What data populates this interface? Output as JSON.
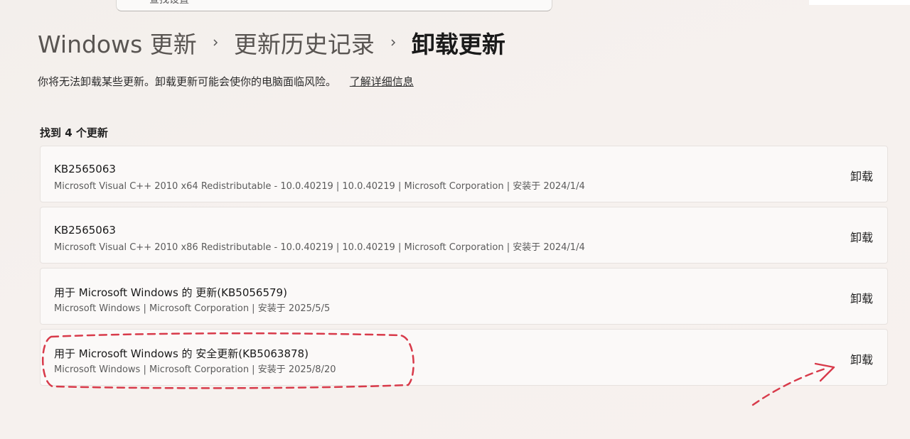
{
  "search": {
    "placeholder": "查找设置"
  },
  "breadcrumb": {
    "items": [
      "Windows 更新",
      "更新历史记录",
      "卸载更新"
    ]
  },
  "warning": {
    "text": "你将无法卸载某些更新。卸载更新可能会使你的电脑面临风险。",
    "link_label": "了解详细信息"
  },
  "summary": {
    "count_label": "找到 4 个更新"
  },
  "updates": [
    {
      "title": "KB2565063",
      "meta": "Microsoft Visual C++ 2010  x64 Redistributable - 10.0.40219  |  10.0.40219  |  Microsoft Corporation  |  安装于 2024/1/4",
      "action_label": "卸载"
    },
    {
      "title": "KB2565063",
      "meta": "Microsoft Visual C++ 2010  x86 Redistributable - 10.0.40219  |  10.0.40219  |  Microsoft Corporation  |  安装于 2024/1/4",
      "action_label": "卸载"
    },
    {
      "title": "用于 Microsoft Windows 的 更新(KB5056579)",
      "meta": "Microsoft Windows  |  Microsoft Corporation  |  安装于 2025/5/5",
      "action_label": "卸载"
    },
    {
      "title": "用于 Microsoft Windows 的 安全更新(KB5063878)",
      "meta": "Microsoft Windows  |  Microsoft Corporation  |  安装于 2025/8/20",
      "action_label": "卸载"
    }
  ],
  "colors": {
    "annotation": "#d83a4a"
  }
}
